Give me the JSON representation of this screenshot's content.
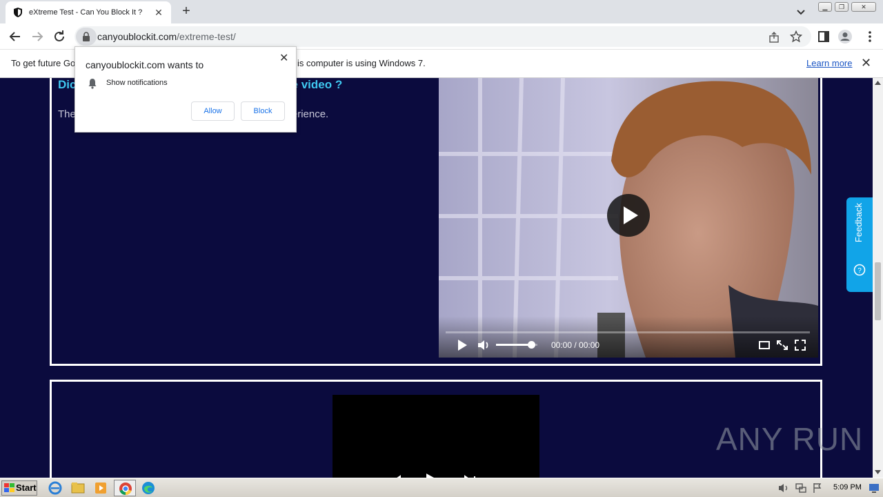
{
  "browser": {
    "tab_title": "eXtreme Test - Can You Block It ?",
    "url_host": "canyoublockit.com",
    "url_path": "/extreme-test/"
  },
  "infobar": {
    "text_left": "To get future Go",
    "text_right": "is computer is using Windows 7.",
    "learn_more": "Learn more"
  },
  "popup": {
    "title": "canyoublockit.com wants to",
    "permission": "Show notifications",
    "allow": "Allow",
    "block": "Block"
  },
  "page": {
    "heading_left": "Dic",
    "heading_right": "the video ?",
    "body_left": "The",
    "body_right": "erience.",
    "video_time": "00:00 / 00:00",
    "volume_level": 0.85,
    "feedback": "Feedback",
    "watermark": "ANY RUN"
  },
  "taskbar": {
    "start": "Start",
    "clock": "5:09 PM"
  },
  "colors": {
    "page_bg": "#0b0b3e",
    "heading": "#3fc8f0",
    "feedback": "#11a4e8",
    "link": "#1a55c4"
  }
}
